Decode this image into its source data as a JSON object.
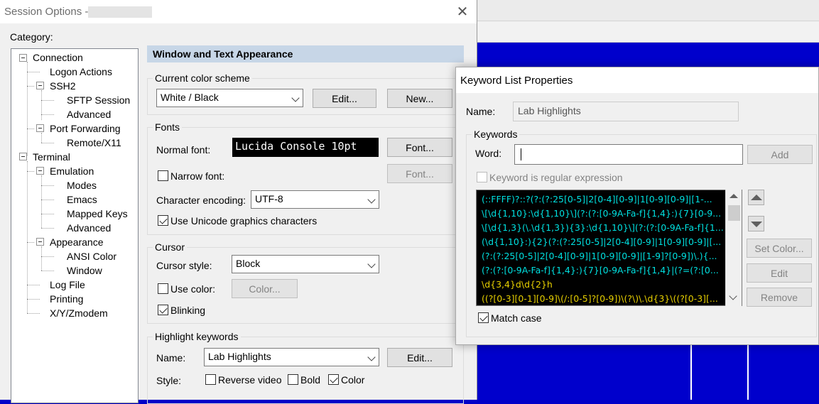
{
  "session": {
    "title": "Session Options -",
    "category_label": "Category:",
    "tree": [
      {
        "label": "Connection"
      },
      {
        "label": "Logon Actions"
      },
      {
        "label": "SSH2"
      },
      {
        "label": "SFTP Session"
      },
      {
        "label": "Advanced"
      },
      {
        "label": "Port Forwarding"
      },
      {
        "label": "Remote/X11"
      },
      {
        "label": "Terminal"
      },
      {
        "label": "Emulation"
      },
      {
        "label": "Modes"
      },
      {
        "label": "Emacs"
      },
      {
        "label": "Mapped Keys"
      },
      {
        "label": "Advanced"
      },
      {
        "label": "Appearance"
      },
      {
        "label": "ANSI Color"
      },
      {
        "label": "Window"
      },
      {
        "label": "Log File"
      },
      {
        "label": "Printing"
      },
      {
        "label": "X/Y/Zmodem"
      }
    ],
    "section_title": "Window and Text Appearance",
    "color_scheme": {
      "group": "Current color scheme",
      "value": "White / Black",
      "edit": "Edit...",
      "new": "New..."
    },
    "fonts": {
      "group": "Fonts",
      "normal_label": "Normal font:",
      "preview": "Lucida Console 10pt",
      "font_btn": "Font...",
      "narrow_label": "Narrow font:",
      "font_btn2": "Font...",
      "encoding_label": "Character encoding:",
      "encoding_value": "UTF-8",
      "unicode_label": "Use Unicode graphics characters"
    },
    "cursor": {
      "group": "Cursor",
      "style_label": "Cursor style:",
      "style_value": "Block",
      "use_color": "Use color:",
      "color_btn": "Color...",
      "blinking": "Blinking"
    },
    "highlight": {
      "group": "Highlight keywords",
      "name_label": "Name:",
      "name_value": "Lab Highlights",
      "edit": "Edit...",
      "style_label": "Style:",
      "reverse": "Reverse video",
      "bold": "Bold",
      "color": "Color"
    }
  },
  "keyword_dialog": {
    "title": "Keyword List Properties",
    "name_label": "Name:",
    "name_value": "Lab Highlights",
    "group": "Keywords",
    "word_label": "Word:",
    "word_value": "",
    "add": "Add",
    "regex_label": "Keyword is regular expression",
    "keywords": [
      {
        "text": "(::FFFF)?::?(?:(?:25[0-5]|2[0-4][0-9]|1[0-9][0-9]|[1-...",
        "color": "#00e0e0"
      },
      {
        "text": "\\[\\d{1,10}:\\d{1,10}\\](?:(?:[0-9A-Fa-f]{1,4}:){7}[0-9...",
        "color": "#00e0e0"
      },
      {
        "text": "\\[\\d{1,3}(\\.\\d{1,3}){3}:\\d{1,10}\\](?:(?:[0-9A-Fa-f]{1...",
        "color": "#00e0e0"
      },
      {
        "text": "(\\d{1,10}:){2}(?:(?:25[0-5]|2[0-4][0-9]|1[0-9][0-9]|[...",
        "color": "#00e0e0"
      },
      {
        "text": "(?:(?:25[0-5]|2[0-4][0-9]|1[0-9][0-9]|[1-9]?[0-9])\\.){...",
        "color": "#00e0e0"
      },
      {
        "text": "(?:(?:[0-9A-Fa-f]{1,4}:){7}[0-9A-Fa-f]{1,4}|(?=(?:[0...",
        "color": "#00e0e0"
      },
      {
        "text": "\\d{3,4}d\\d{2}h",
        "color": "#e8d000"
      },
      {
        "text": "((?[0-3][0-1][0-9]\\(/:[0-5]?[0-9])\\(?\\)\\.\\d{3}\\((?[0-3][...",
        "color": "#e8d000"
      }
    ],
    "set_color": "Set Color...",
    "edit": "Edit",
    "remove": "Remove",
    "match_case": "Match case"
  }
}
